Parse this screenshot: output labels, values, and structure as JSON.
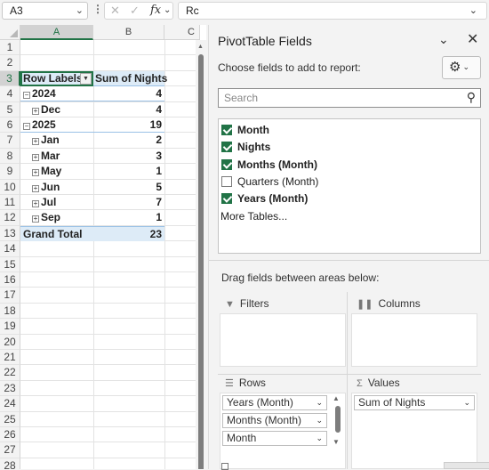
{
  "formula_bar": {
    "name_box": "A3",
    "fx_label": "fx",
    "content": "Rc"
  },
  "columns": [
    "A",
    "B",
    "C"
  ],
  "row_numbers": [
    "1",
    "2",
    "3",
    "4",
    "5",
    "6",
    "7",
    "8",
    "9",
    "10",
    "11",
    "12",
    "13",
    "14",
    "15",
    "16",
    "17",
    "18",
    "19",
    "20",
    "21",
    "22",
    "23",
    "24",
    "25",
    "26",
    "27",
    "28"
  ],
  "pivot": {
    "row_labels_header": "Row Labels",
    "values_header": "Sum of Nights",
    "rows": [
      {
        "label": "2024",
        "value": "4",
        "level": 0,
        "expander": "⊟"
      },
      {
        "label": "Dec",
        "value": "4",
        "level": 1,
        "expander": "⊞"
      },
      {
        "label": "2025",
        "value": "19",
        "level": 0,
        "expander": "⊟"
      },
      {
        "label": "Jan",
        "value": "2",
        "level": 1,
        "expander": "⊞"
      },
      {
        "label": "Mar",
        "value": "3",
        "level": 1,
        "expander": "⊞"
      },
      {
        "label": "May",
        "value": "1",
        "level": 1,
        "expander": "⊞"
      },
      {
        "label": "Jun",
        "value": "5",
        "level": 1,
        "expander": "⊞"
      },
      {
        "label": "Jul",
        "value": "7",
        "level": 1,
        "expander": "⊞"
      },
      {
        "label": "Sep",
        "value": "1",
        "level": 1,
        "expander": "⊞"
      }
    ],
    "grand_total_label": "Grand Total",
    "grand_total_value": "23"
  },
  "pane": {
    "title": "PivotTable Fields",
    "subtitle": "Choose fields to add to report:",
    "search_placeholder": "Search",
    "fields": [
      {
        "label": "Month",
        "checked": true
      },
      {
        "label": "Nights",
        "checked": true
      },
      {
        "label": "Months (Month)",
        "checked": true
      },
      {
        "label": "Quarters (Month)",
        "checked": false
      },
      {
        "label": "Years (Month)",
        "checked": true
      }
    ],
    "more_tables": "More Tables...",
    "drag_label": "Drag fields between areas below:",
    "areas": {
      "filters": "Filters",
      "columns": "Columns",
      "rows": "Rows",
      "values": "Values"
    },
    "rows_items": [
      "Years (Month)",
      "Months (Month)",
      "Month"
    ],
    "values_items": [
      "Sum of Nights"
    ]
  },
  "colors": {
    "accent": "#217346",
    "pivot_header_fill": "#ddebf7",
    "pivot_border": "#9bc2e6"
  }
}
